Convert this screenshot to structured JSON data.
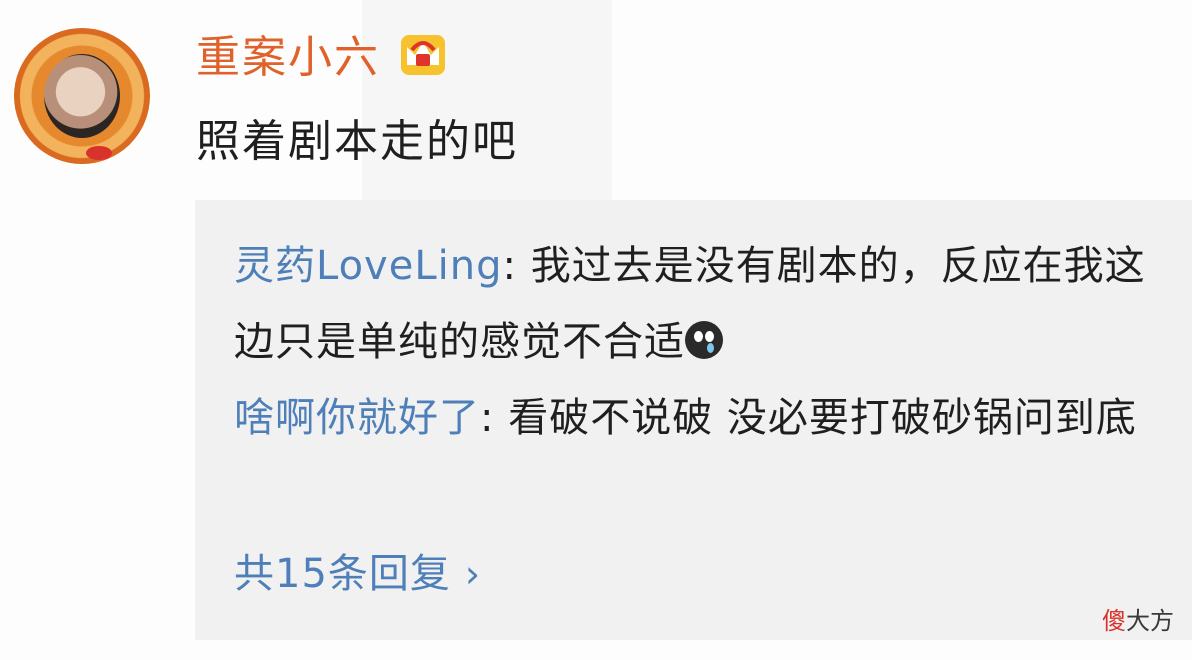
{
  "post": {
    "username": "重案小六",
    "comment": "照着剧本走的吧",
    "username_color": "#e0622a",
    "badge_icon": "crown-vip-icon"
  },
  "replies": [
    {
      "author": "灵药LoveLing",
      "separator": ": ",
      "text": "我过去是没有剧本的，反应在我这边只是单纯的感觉不合适",
      "emoji": "crying-face-emoji"
    },
    {
      "author": "啥啊你就好了",
      "separator": ": ",
      "text": "看破不说破 没必要打破砂锅问到底"
    }
  ],
  "more_replies": {
    "label": "共15条回复",
    "chevron": "›"
  },
  "watermark": {
    "part1": "傻",
    "part2": "大方"
  },
  "colors": {
    "link": "#4f7fb8",
    "reply_background": "#f1f1f1",
    "text": "#1f1f1f"
  }
}
